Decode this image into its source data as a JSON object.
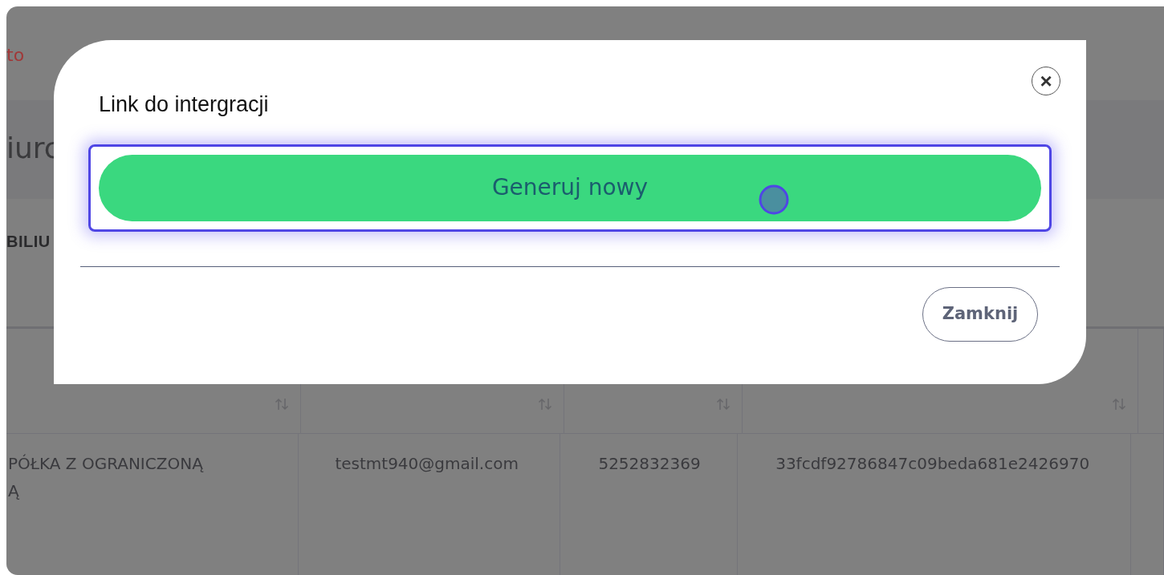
{
  "background": {
    "link_fragment": "to",
    "heading_fragment": "iurc",
    "section_fragment": "BILIU",
    "table": {
      "columns": [
        {
          "sortable": true
        },
        {
          "sortable": true
        },
        {
          "sortable": true
        },
        {
          "sortable": true
        },
        {
          "sortable": false
        }
      ],
      "rows": [
        {
          "cells": [
            [
              "PÓŁKA Z OGRANICZONĄ",
              "Ą"
            ],
            [
              "testmt940@gmail.com"
            ],
            [
              "5252832369"
            ],
            [
              "33fcdf92786847c09beda681e2426970"
            ],
            []
          ]
        }
      ]
    }
  },
  "dialog": {
    "title": "Link do intergracji",
    "close_label": "×",
    "generate_button": {
      "label": "Generuj nowy",
      "focused": true
    },
    "close_button": {
      "label": "Zamknij"
    }
  }
}
